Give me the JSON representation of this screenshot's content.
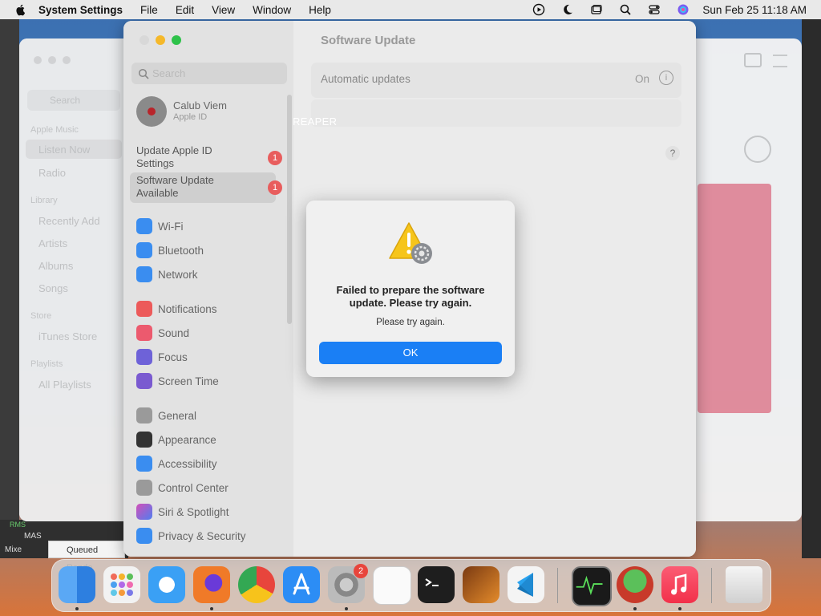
{
  "menubar": {
    "app_name": "System Settings",
    "menus": [
      "File",
      "Edit",
      "View",
      "Window",
      "Help"
    ],
    "clock": "Sun Feb 25  11:18 AM"
  },
  "music": {
    "search_placeholder": "Search",
    "sections": {
      "apple_music": "Apple Music",
      "library": "Library",
      "store": "Store",
      "playlists": "Playlists"
    },
    "items": {
      "listen_now": "Listen Now",
      "radio": "Radio",
      "recently_added": "Recently Add",
      "artists": "Artists",
      "albums": "Albums",
      "songs": "Songs",
      "itunes_store": "iTunes Store",
      "all_playlists": "All Playlists"
    }
  },
  "reaper": {
    "title": "REAPER",
    "queued_render": "Queued Rende",
    "rms": "RMS",
    "mas": "MAS",
    "mixer": "Mixe"
  },
  "settings": {
    "window_title": "Software Update",
    "search_placeholder": "Search",
    "profile": {
      "name": "Calub Viem",
      "subtitle": "Apple ID"
    },
    "notices": [
      {
        "label_line1": "Update Apple ID",
        "label_line2": "Settings",
        "badge": "1"
      },
      {
        "label_line1": "Software Update",
        "label_line2": "Available",
        "badge": "1"
      }
    ],
    "nav": {
      "wifi": "Wi-Fi",
      "bluetooth": "Bluetooth",
      "network": "Network",
      "notifications": "Notifications",
      "sound": "Sound",
      "focus": "Focus",
      "screen_time": "Screen Time",
      "general": "General",
      "appearance": "Appearance",
      "accessibility": "Accessibility",
      "control_center": "Control Center",
      "siri_spotlight": "Siri & Spotlight",
      "privacy_security": "Privacy & Security"
    },
    "automatic_updates": {
      "label": "Automatic updates",
      "value": "On"
    },
    "help": "?"
  },
  "dialog": {
    "message": "Failed to prepare the software update. Please try again.",
    "detail": "Please try again.",
    "ok": "OK"
  },
  "dock": {
    "settings_badge": "2",
    "apps": [
      "finder-icon",
      "launchpad-icon",
      "safari-icon",
      "firefox-icon",
      "chrome-icon",
      "app-store-icon",
      "system-settings-icon",
      "textedit-icon",
      "terminal-icon",
      "garageband-icon",
      "vscode-icon",
      "activity-monitor-icon",
      "reaper-icon",
      "music-icon",
      "trash-icon"
    ]
  }
}
